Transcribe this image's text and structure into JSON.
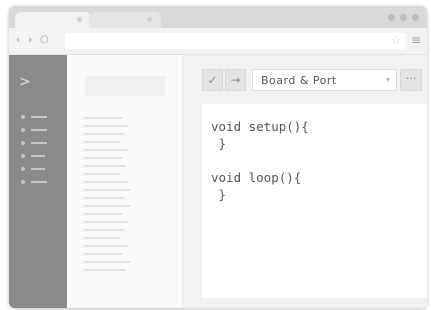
{
  "browser": {
    "nav": {
      "back": "‹",
      "forward": "›",
      "reload": "○"
    },
    "star_icon": "☆",
    "menu_icon": "≡"
  },
  "ide": {
    "toolbar": {
      "verify_icon": "✓",
      "upload_icon": "→",
      "board_select": "Board & Port",
      "board_caret": "▾",
      "more_icon": "···"
    },
    "sidebar": {
      "expand_icon": ">"
    },
    "code": "void setup(){\n }\n\nvoid loop(){\n }"
  }
}
